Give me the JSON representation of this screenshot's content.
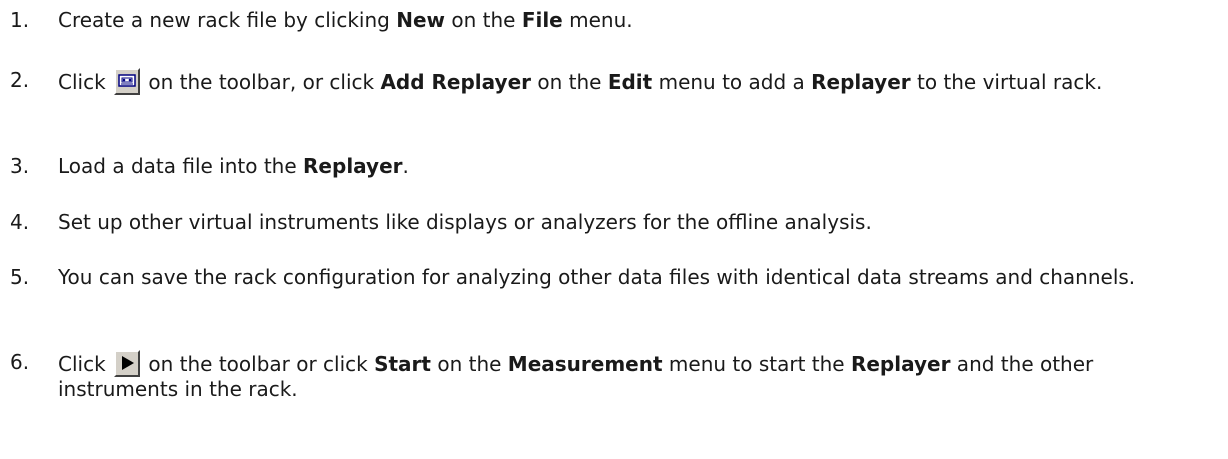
{
  "steps": [
    {
      "num": "1.",
      "t1": "Create a new rack file by clicking ",
      "b1": "New",
      "t2": " on the ",
      "b2": "File",
      "t3": " menu."
    },
    {
      "num": "2.",
      "t1": "Click ",
      "icon": "replayer-tape-icon",
      "t2": " on the toolbar, or click ",
      "b1": "Add Replayer",
      "t3": " on the ",
      "b2": "Edit",
      "t4": " menu to add a ",
      "b3": "Replayer",
      "t5": " to the virtual rack."
    },
    {
      "num": "3.",
      "t1": "Load a data file into the ",
      "b1": "Replayer",
      "t2": "."
    },
    {
      "num": "4.",
      "t1": "Set up other virtual instruments like displays or analyzers for the offline analysis."
    },
    {
      "num": "5.",
      "t1": "You can save the rack configuration for analyzing other data files with identical data streams and channels."
    },
    {
      "num": "6.",
      "t1": "Click ",
      "icon": "play-icon",
      "t2": " on the toolbar or click ",
      "b1": "Start",
      "t3": " on the ",
      "b2": "Measurement",
      "t4": " menu to start the ",
      "b3": "Replayer",
      "t5": " and the other instruments in the rack."
    }
  ]
}
